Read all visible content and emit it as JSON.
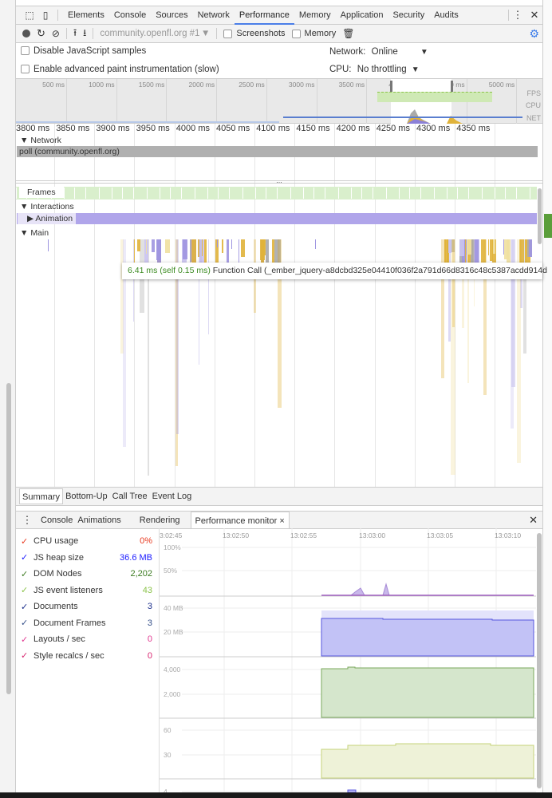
{
  "devtools_tabs": [
    "Elements",
    "Console",
    "Sources",
    "Network",
    "Performance",
    "Memory",
    "Application",
    "Security",
    "Audits"
  ],
  "active_tab": "Performance",
  "toolbar": {
    "profile_select": "community.openfl.org #1",
    "screenshots_label": "Screenshots",
    "memory_label": "Memory"
  },
  "options": {
    "disable_js_samples": "Disable JavaScript samples",
    "advanced_paint": "Enable advanced paint instrumentation (slow)",
    "network_label": "Network:",
    "network_value": "Online",
    "cpu_label": "CPU:",
    "cpu_value": "No throttling"
  },
  "overview": {
    "ticks": [
      "500 ms",
      "1000 ms",
      "1500 ms",
      "2000 ms",
      "2500 ms",
      "3000 ms",
      "3500 ms",
      "4000 ms",
      "4500 ms",
      "5000 ms"
    ],
    "lanes": [
      "FPS",
      "CPU",
      "NET"
    ]
  },
  "ruler": [
    "3800 ms",
    "3850 ms",
    "3900 ms",
    "3950 ms",
    "4000 ms",
    "4050 ms",
    "4100 ms",
    "4150 ms",
    "4200 ms",
    "4250 ms",
    "4300 ms",
    "4350 ms"
  ],
  "tracks": {
    "network": "Network",
    "poll": "poll (community.openfl.org)",
    "frames": "Frames",
    "interactions": "Interactions",
    "animation": "Animation",
    "main": "Main"
  },
  "tooltip": {
    "time": "6.41 ms (self 0.15 ms)",
    "label": "Function Call (_ember_jquery-a8dcbd325e04410f036f2a791d66d8316c48c5387acdd914d"
  },
  "bottom_tabs": [
    "Summary",
    "Bottom-Up",
    "Call Tree",
    "Event Log"
  ],
  "drawer_tabs": [
    "Console",
    "Animations",
    "Rendering",
    "Performance monitor"
  ],
  "metrics": [
    {
      "label": "CPU usage",
      "value": "0%",
      "color": "#e8391f"
    },
    {
      "label": "JS heap size",
      "value": "36.6 MB",
      "color": "#1a1aff"
    },
    {
      "label": "DOM Nodes",
      "value": "2,202",
      "color": "#3a7a1f"
    },
    {
      "label": "JS event listeners",
      "value": "43",
      "color": "#8bc34a"
    },
    {
      "label": "Documents",
      "value": "3",
      "color": "#1c2f8c"
    },
    {
      "label": "Document Frames",
      "value": "3",
      "color": "#36508a"
    },
    {
      "label": "Layouts / sec",
      "value": "0",
      "color": "#e0368f"
    },
    {
      "label": "Style recalcs / sec",
      "value": "0",
      "color": "#d8246e"
    }
  ],
  "monitor": {
    "times": [
      "3:02:45",
      "13:02:50",
      "13:02:55",
      "13:03:00",
      "13:03:05",
      "13:03:10"
    ],
    "cpu_ticks": [
      "100%",
      "50%"
    ],
    "heap_ticks": [
      "40 MB",
      "20 MB"
    ],
    "dom_ticks": [
      "4,000",
      "2,000"
    ],
    "listener_ticks": [
      "60",
      "30"
    ],
    "doc_ticks": [
      "4"
    ]
  }
}
